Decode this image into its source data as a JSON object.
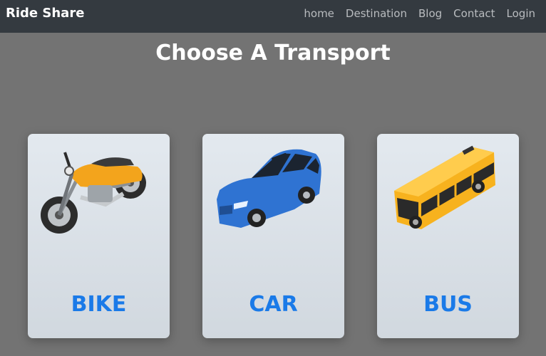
{
  "navbar": {
    "brand": "Ride Share",
    "links": [
      "home",
      "Destination",
      "Blog",
      "Contact",
      "Login"
    ]
  },
  "page": {
    "title": "Choose A Transport"
  },
  "cards": [
    {
      "label": "BIKE",
      "icon": "motorcycle-icon"
    },
    {
      "label": "CAR",
      "icon": "car-icon"
    },
    {
      "label": "BUS",
      "icon": "bus-icon"
    }
  ],
  "colors": {
    "navbar_bg": "#343a40",
    "page_bg": "#737373",
    "card_label": "#1a7ae8",
    "title": "#ffffff"
  }
}
